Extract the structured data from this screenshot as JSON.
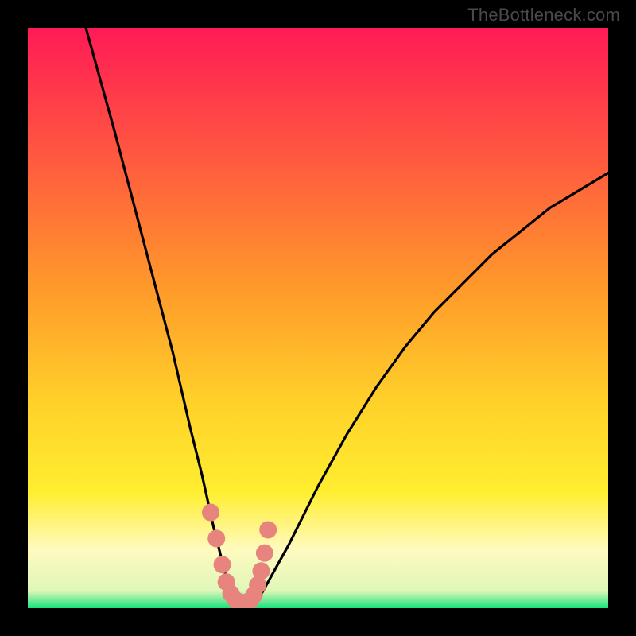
{
  "watermark": "TheBottleneck.com",
  "colors": {
    "gradient_top": "#ff1a56",
    "gradient_mid1": "#ff5840",
    "gradient_mid2": "#ff9a2a",
    "gradient_mid3": "#ffd22a",
    "gradient_yellow": "#ffee30",
    "gradient_cream": "#fffac0",
    "gradient_green": "#17e37d",
    "curve": "#000000",
    "marker": "#e8847e"
  },
  "chart_data": {
    "type": "line",
    "title": "",
    "xlabel": "",
    "ylabel": "",
    "xlim": [
      0,
      100
    ],
    "ylim": [
      0,
      100
    ],
    "note": "Axis values are relative percentages inferred from the plot area; no numeric axis ticks are shown in the image.",
    "series": [
      {
        "name": "bottleneck-curve",
        "x": [
          10,
          15,
          20,
          25,
          28,
          30,
          32,
          34,
          35,
          36,
          37,
          38,
          40,
          45,
          50,
          55,
          60,
          65,
          70,
          75,
          80,
          85,
          90,
          95,
          100
        ],
        "y": [
          100,
          82,
          63,
          44,
          31,
          23,
          14,
          6,
          3,
          1,
          1,
          1,
          2,
          11,
          21,
          30,
          38,
          45,
          51,
          56,
          61,
          65,
          69,
          72,
          75
        ]
      }
    ],
    "markers": {
      "name": "highlight-points",
      "x": [
        31.5,
        32.5,
        33.5,
        34.2,
        35.0,
        35.8,
        36.6,
        37.4,
        38.3,
        39.0,
        39.6,
        40.2,
        40.8,
        41.4
      ],
      "y": [
        16.5,
        12.0,
        7.5,
        4.5,
        2.5,
        1.4,
        1.0,
        1.0,
        1.3,
        2.3,
        4.0,
        6.4,
        9.5,
        13.5
      ]
    }
  }
}
